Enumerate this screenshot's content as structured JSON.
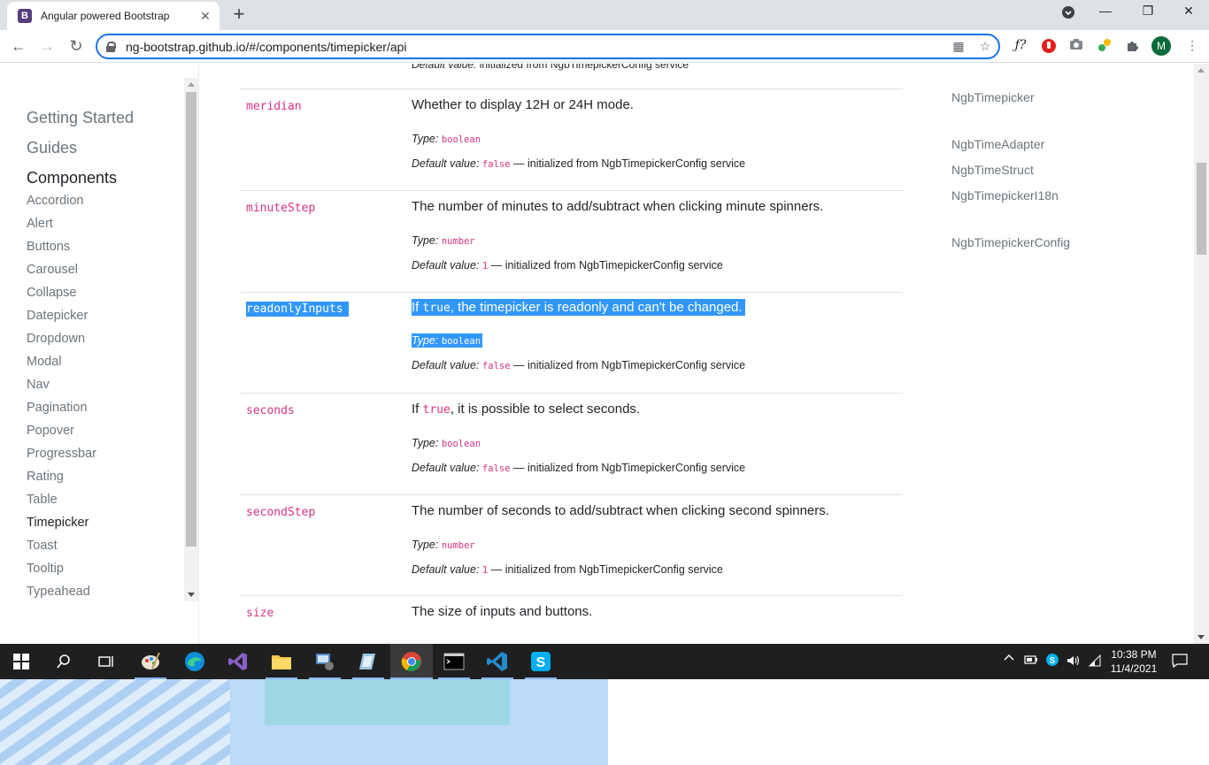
{
  "browser": {
    "tab_title": "Angular powered Bootstrap",
    "tab_icon": "B",
    "url": "ng-bootstrap.github.io/#/components/timepicker/api",
    "avatar_letter": "M"
  },
  "leftnav": {
    "sections": [
      "Getting Started",
      "Guides",
      "Components"
    ],
    "items": [
      "Accordion",
      "Alert",
      "Buttons",
      "Carousel",
      "Collapse",
      "Datepicker",
      "Dropdown",
      "Modal",
      "Nav",
      "Pagination",
      "Popover",
      "Progressbar",
      "Rating",
      "Table",
      "Timepicker",
      "Toast",
      "Tooltip",
      "Typeahead"
    ],
    "active_item": "Timepicker"
  },
  "content": {
    "partial_top": "initialized from NgbTimepickerConfig service",
    "type_label": "Type:",
    "default_label": "Default value:",
    "config_suffix": "— initialized from NgbTimepickerConfig service",
    "rows": [
      {
        "name": "meridian",
        "desc": "Whether to display 12H or 24H mode.",
        "type": "boolean",
        "default": "false"
      },
      {
        "name": "minuteStep",
        "desc": "The number of minutes to add/subtract when clicking minute spinners.",
        "type": "number",
        "default": "1"
      },
      {
        "name": "readonlyInputs",
        "desc_pre": "If ",
        "desc_code": "true",
        "desc_post": ", the timepicker is readonly and can't be changed.",
        "type": "boolean",
        "default": "false"
      },
      {
        "name": "seconds",
        "desc_pre": "If ",
        "desc_code": "true",
        "desc_post": ", it is possible to select seconds.",
        "type": "boolean",
        "default": "false"
      },
      {
        "name": "secondStep",
        "desc": "The number of seconds to add/subtract when clicking second spinners.",
        "type": "number",
        "default": "1"
      },
      {
        "name": "size",
        "desc": "The size of inputs and buttons."
      }
    ]
  },
  "rightnav": {
    "items": [
      "NgbTimepicker",
      "NgbTimeAdapter",
      "NgbTimeStruct",
      "NgbTimepickerI18n",
      "NgbTimepickerConfig"
    ]
  },
  "taskbar": {
    "time": "10:38 PM",
    "date": "11/4/2021"
  }
}
